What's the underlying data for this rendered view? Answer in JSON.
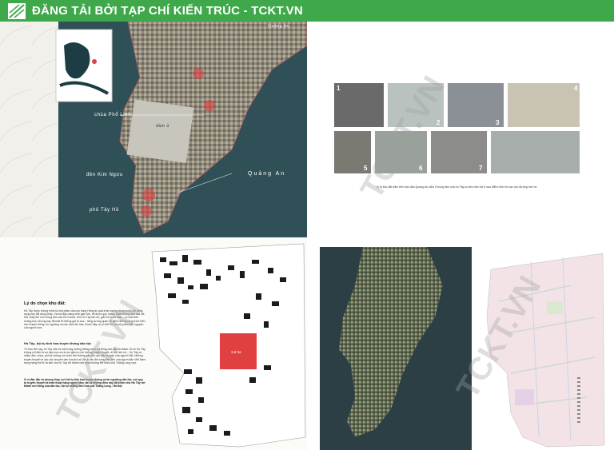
{
  "banner": {
    "title": "ĐĂNG TẢI BỞI TẠP CHÍ KIẾN TRÚC - TCKT.VN"
  },
  "satellite": {
    "corner_label": "Quảng An",
    "labels": {
      "chua_pho_linh": "chùa Phổ Linh",
      "den_kim_nguu": "đền Kim Ngưu",
      "pho_tay_ho": "phủ Tây Hồ",
      "quang_an": "Quảng An",
      "site": "đầm ủ"
    }
  },
  "photos": {
    "caption": "Vị trí khu đất nằm trên bán đảo Quảng An nằm ở trung tâm của hồ Tây,có tầm nhìn tốt ở sau điểm nhìn tới các con đường ven hồ.",
    "numbers": [
      "1",
      "2",
      "3",
      "4",
      "5",
      "6",
      "7"
    ]
  },
  "reasons": {
    "heading": "Lý do chọn khu đất:",
    "p1": "Hồ Tây được chồng mình là một phần của con sông Hồng do quá trình ngưng dòng nước khi dòng sông này đổi dòng chảy. Và mà đây mang thời gian lớn, sẽ được quy hoạch thành trung tâm của Hà Nội, thay thế vị trí trung tâm của Hồ Gươm. Khu hồ Tây lịch sử, gắn với mậu dịch... có một thời hoàng kim, nhưng nay đã mất đi những giá trị xưa... tăng cường quan hệ giữa những công trình kiến trúc truyền thống, tín ngưỡng và các nhà văn hóa. Được đây, ta có thể tìm ra một phần bản nguyên của người xưa.",
    "subheading": "Hồ Tây- bội tụ tinh hoa truyền thống dân tộc",
    "p2": "Từ bao đời nay, hồ Tây luôn là một trong những thắng cảnh nổi tiếng của đất Hà thành. Đi về Hồ Tây không chỉ đến là vui đẹp mà còn là nơi gắn bó với những truyền thuyết, di tích lịch sử... Hồ Tây có nhiều đền, chùa, phủ là những nơi chốn linh thiêng gắn với các câu chuyện của người Việt. Những truyền thuyết về các câu chuyện văn hóa lịch sử đã đi vào đời sống tâm linh của người dân Việt Nam trong hàng thế kỉ và làm cho hồ Tây trở thành một phần không thể thiếu của Thăng Long xưa.",
    "p3": "Vì vị đặc đắc về phong thủy, nơi hội tụ tinh hoa truyền thống và tín ngưỡng dân tộc, nơi quy tụ truyền thuyết và thần thoại hàng nghìn năm, tất cả những điều này đã khiến cho Hồ Tây trở thành nơi đóng của dân tộc, hội tụ những tinh hoa của Thăng Long - Hà Nội."
  },
  "site_plan": {
    "area_label": "3,8 ha"
  },
  "watermark": "TCKT.VN",
  "colors": {
    "banner": "#3fa84a",
    "site": "#e0403f",
    "water": "#2e4f57"
  }
}
